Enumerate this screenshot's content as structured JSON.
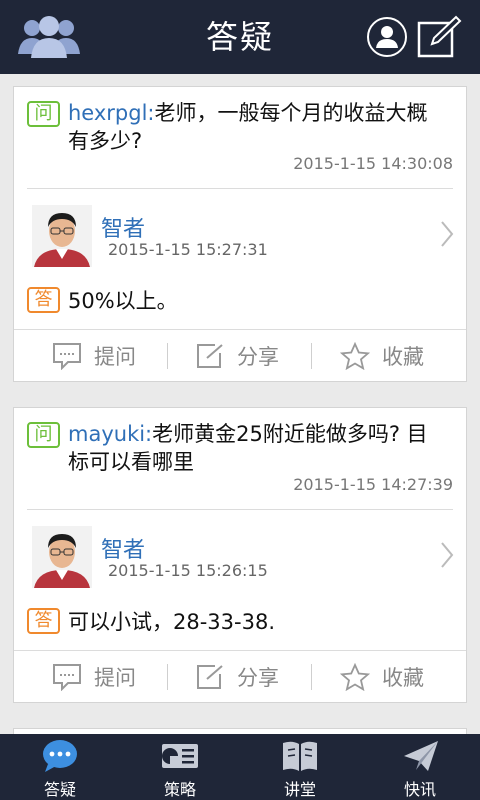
{
  "header": {
    "title": "答疑"
  },
  "cards": [
    {
      "q_badge": "问",
      "asker": "hexrpgl:",
      "question": "老师，一般每个月的收益大概有多少?",
      "question_time": "2015-1-15 14:30:08",
      "expert": "智者",
      "answer_time": "2015-1-15 15:27:31",
      "a_badge": "答",
      "answer": "50%以上。"
    },
    {
      "q_badge": "问",
      "asker": "mayuki:",
      "question": "老师黄金25附近能做多吗? 目标可以看哪里",
      "question_time": "2015-1-15 14:27:39",
      "expert": "智者",
      "answer_time": "2015-1-15 15:26:15",
      "a_badge": "答",
      "answer": "可以小试，28-33-38."
    }
  ],
  "actions": {
    "ask": "提问",
    "share": "分享",
    "favorite": "收藏"
  },
  "tabs": [
    {
      "label": "答疑",
      "icon": "chat-bubble-icon"
    },
    {
      "label": "策略",
      "icon": "strategy-icon"
    },
    {
      "label": "讲堂",
      "icon": "book-icon"
    },
    {
      "label": "快讯",
      "icon": "paper-plane-icon"
    }
  ],
  "colors": {
    "bar_bg": "#1f2638",
    "accent_blue": "#2f6fb7",
    "question_green": "#6cbf3a",
    "answer_orange": "#f0892d",
    "active_tab": "#3d8fe0"
  }
}
